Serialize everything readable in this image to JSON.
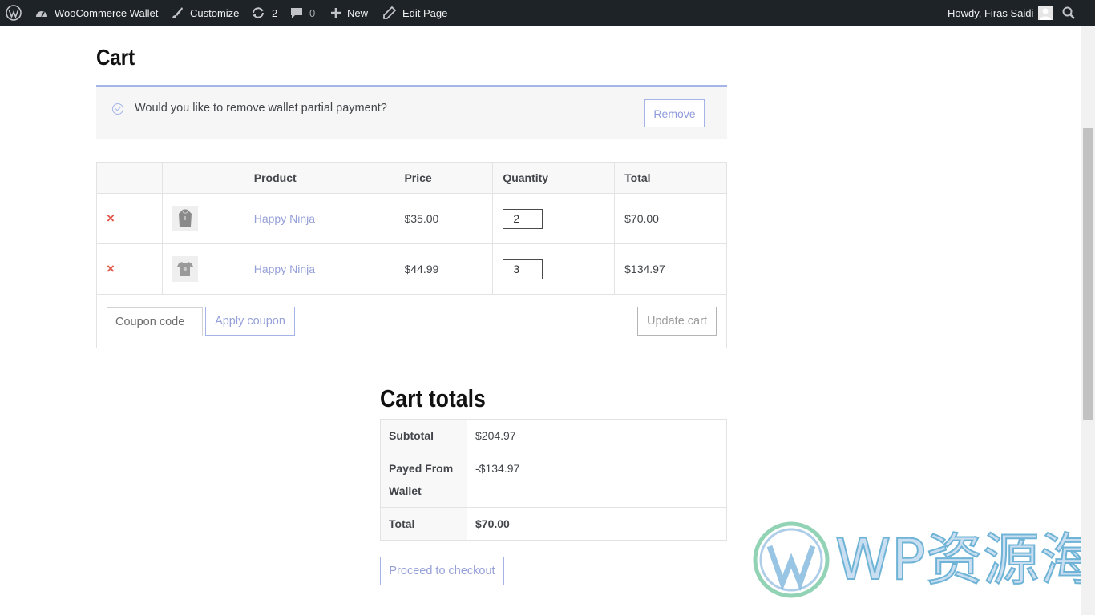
{
  "admin_bar": {
    "site_name": "WooCommerce Wallet",
    "customize": "Customize",
    "updates_count": "2",
    "comments_count": "0",
    "new_label": "New",
    "edit_page": "Edit Page",
    "greeting": "Howdy, Firas Saidi"
  },
  "page": {
    "title": "Cart"
  },
  "notice": {
    "message": "Would you like to remove wallet partial payment?",
    "remove_button": "Remove"
  },
  "cart_table": {
    "headers": [
      "",
      "",
      "Product",
      "Price",
      "Quantity",
      "Total"
    ],
    "rows": [
      {
        "remove": "×",
        "thumb_icon": "hoodie-icon",
        "product": "Happy Ninja",
        "price": "$35.00",
        "quantity": "2",
        "total": "$70.00"
      },
      {
        "remove": "×",
        "thumb_icon": "tshirt-icon",
        "product": "Happy Ninja",
        "price": "$44.99",
        "quantity": "3",
        "total": "$134.97"
      }
    ],
    "coupon_placeholder": "Coupon code",
    "apply_coupon": "Apply coupon",
    "update_cart": "Update cart"
  },
  "cart_totals": {
    "title": "Cart totals",
    "rows": [
      {
        "label": "Subtotal",
        "value": "$204.97"
      },
      {
        "label": "Payed From Wallet",
        "value": "-$134.97"
      },
      {
        "label": "Total",
        "value": "$70.00"
      }
    ],
    "checkout_button": "Proceed to checkout"
  },
  "watermark": {
    "text": "WP资源海"
  },
  "colors": {
    "admin_bar_bg": "#1d2327",
    "accent": "#a5b4e8",
    "link": "#96a0d8",
    "remove": "#e2574c"
  }
}
